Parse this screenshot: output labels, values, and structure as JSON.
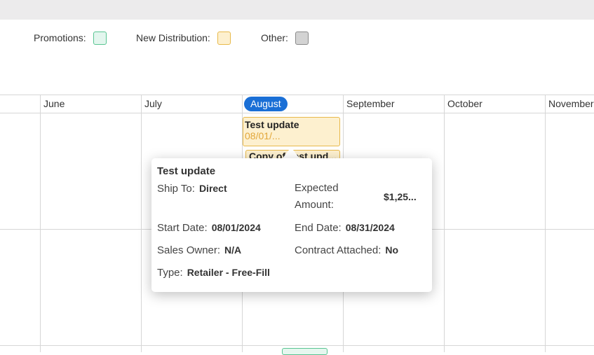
{
  "legend": {
    "items": [
      {
        "label": "Promotions:",
        "fill": "#e3f6ee",
        "border": "#58c592"
      },
      {
        "label": "New Distribution:",
        "fill": "#fdf0cf",
        "border": "#e8b94a"
      },
      {
        "label": "Other:",
        "fill": "#d3d3d3",
        "border": "#8a8a8a"
      }
    ]
  },
  "calendar": {
    "months": [
      "June",
      "July",
      "August",
      "September",
      "October",
      "November"
    ],
    "current_month": "August",
    "current_month_color": "#1a6fd6"
  },
  "events": {
    "primary": {
      "title": "Test update",
      "date": "08/01/..."
    },
    "secondary": {
      "title": "Copy of Test upd..."
    }
  },
  "popover": {
    "title": "Test update",
    "ship_to_label": "Ship To:",
    "ship_to_value": "Direct",
    "expected_amount_label": "Expected Amount:",
    "expected_amount_value": "$1,25...",
    "start_date_label": "Start Date:",
    "start_date_value": "08/01/2024",
    "end_date_label": "End Date:",
    "end_date_value": "08/31/2024",
    "sales_owner_label": "Sales Owner:",
    "sales_owner_value": "N/A",
    "contract_label": "Contract Attached:",
    "contract_value": "No",
    "type_label": "Type:",
    "type_value": "Retailer - Free-Fill"
  }
}
